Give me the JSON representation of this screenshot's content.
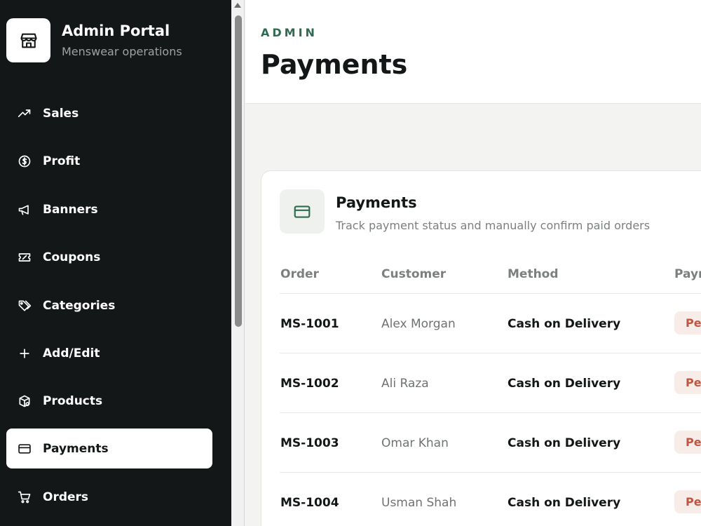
{
  "brand": {
    "title": "Admin Portal",
    "subtitle": "Menswear operations",
    "icon": "storefront-icon"
  },
  "nav": {
    "items": [
      {
        "label": "Sales",
        "icon": "trending-up-icon"
      },
      {
        "label": "Profit",
        "icon": "dollar-circle-icon"
      },
      {
        "label": "Banners",
        "icon": "megaphone-icon"
      },
      {
        "label": "Coupons",
        "icon": "ticket-icon"
      },
      {
        "label": "Categories",
        "icon": "tags-icon"
      },
      {
        "label": "Add/Edit",
        "icon": "plus-icon"
      },
      {
        "label": "Products",
        "icon": "package-icon"
      },
      {
        "label": "Payments",
        "icon": "credit-card-icon",
        "active": true
      },
      {
        "label": "Orders",
        "icon": "cart-icon"
      }
    ]
  },
  "header": {
    "eyebrow": "ADMIN",
    "title": "Payments"
  },
  "card": {
    "title": "Payments",
    "subtitle": "Track payment status and manually confirm paid orders",
    "icon": "credit-card-icon"
  },
  "table": {
    "columns": [
      "Order",
      "Customer",
      "Method",
      "Payment"
    ],
    "rows": [
      {
        "order": "MS-1001",
        "customer": "Alex Morgan",
        "method": "Cash on Delivery",
        "payment": "Pending"
      },
      {
        "order": "MS-1002",
        "customer": "Ali Raza",
        "method": "Cash on Delivery",
        "payment": "Pending"
      },
      {
        "order": "MS-1003",
        "customer": "Omar Khan",
        "method": "Cash on Delivery",
        "payment": "Pending"
      },
      {
        "order": "MS-1004",
        "customer": "Usman Shah",
        "method": "Cash on Delivery",
        "payment": "Pending"
      }
    ]
  },
  "colors": {
    "sidebar_bg": "#141717",
    "accent_green": "#2f6b50",
    "pending_text": "#c0563f",
    "pending_bg": "#f7ece8"
  }
}
